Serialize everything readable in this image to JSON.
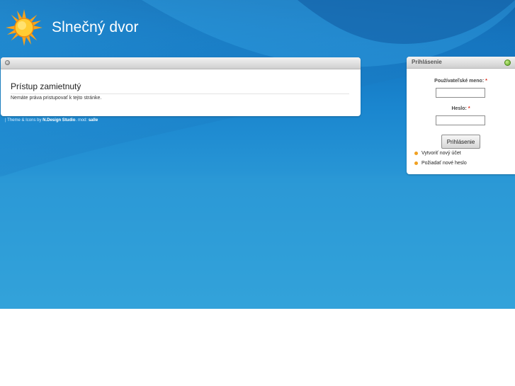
{
  "site": {
    "title": "Slnečný dvor"
  },
  "content": {
    "title": "Prístup zamietnutý",
    "message": "Nemáte práva pristupovať k tejto stránke."
  },
  "footer": {
    "prefix": "| Theme & Icons by ",
    "author": "N.Design Studio",
    "mod_prefix": ". mod: ",
    "mod_author": "salle"
  },
  "login": {
    "title": "Prihlásenie",
    "username_label": "Používateľské meno:",
    "password_label": "Heslo:",
    "required_mark": "*",
    "username_value": "",
    "password_value": "",
    "submit_label": "Prihlásenie",
    "links": [
      {
        "label": "Vytvoriť nový účet"
      },
      {
        "label": "Požiadať nové heslo"
      }
    ]
  },
  "colors": {
    "background_blue": "#1a86cf",
    "sun": "#f7a21c",
    "bullet": "#f0a020",
    "required": "#d21111",
    "status_dot": "#5aa01e"
  },
  "icons": [
    "sun-logo-icon",
    "window-dot-icon",
    "toggle-dot-icon",
    "bullet-icon"
  ]
}
